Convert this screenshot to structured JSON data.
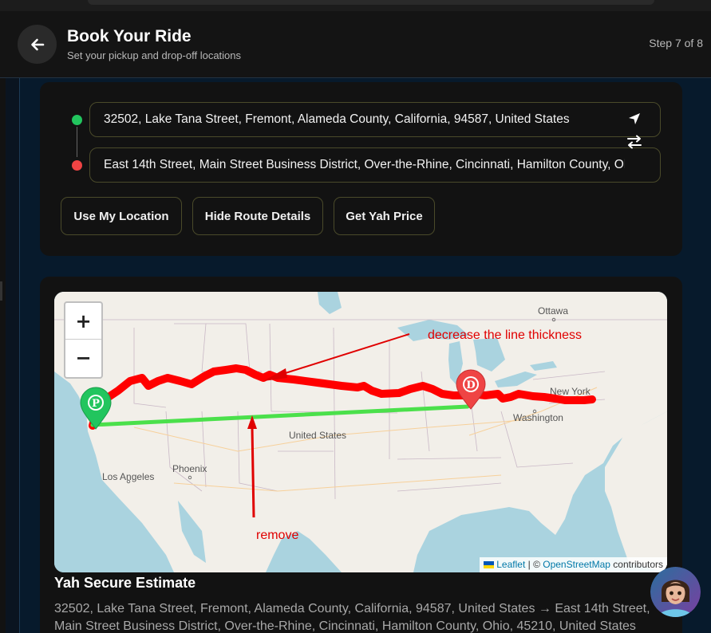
{
  "header": {
    "title": "Book Your Ride",
    "subtitle": "Set your pickup and drop-off locations",
    "step": "Step 7 of 8"
  },
  "route": {
    "pickup_value": "32502, Lake Tana Street, Fremont, Alameda County, California, 94587, United States",
    "dropoff_value": "East 14th Street, Main Street Business District, Over-the-Rhine, Cincinnati, Hamilton County, Ohio, 45210, United States"
  },
  "actions": {
    "use_location": "Use My Location",
    "hide_route": "Hide Route Details",
    "get_price": "Get Yah Price"
  },
  "map": {
    "zoom_in": "+",
    "zoom_out": "−",
    "labels": {
      "ottawa": "Ottawa",
      "new_york": "New York",
      "washington": "Washington",
      "united_states": "United States",
      "phoenix": "Phoenix",
      "los_angeles": "Los Angeles"
    },
    "pickup_marker": "P",
    "dropoff_marker": "D",
    "attribution": {
      "leaflet": "Leaflet",
      "separator": " | © ",
      "osm": "OpenStreetMap",
      "suffix": " contributors"
    },
    "annotations": {
      "thickness_note": "decrease the line thickness",
      "remove_note": "remove"
    },
    "colors": {
      "route_line": "#ff0000",
      "straight_line": "#4be04b",
      "annotation": "#e00000",
      "pickup_marker": "#22c55e",
      "dropoff_marker": "#ef4444"
    }
  },
  "estimate": {
    "title": "Yah Secure Estimate",
    "summary": "32502, Lake Tana Street, Fremont, Alameda County, California, 94587, United States → East 14th Street, Main Street Business District, Over-the-Rhine, Cincinnati, Hamilton County, Ohio, 45210, United States"
  },
  "icons": {
    "back": "arrow-left-icon",
    "navigate": "navigation-arrow-icon",
    "swap": "swap-icon",
    "flag": "ukraine-flag-icon"
  }
}
